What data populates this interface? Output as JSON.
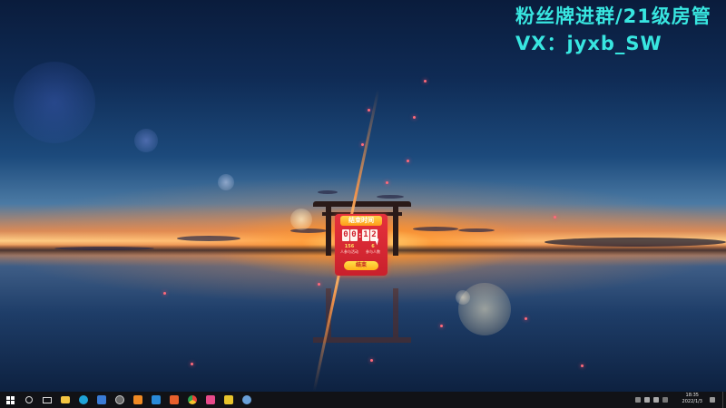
{
  "overlay": {
    "line1": "粉丝牌进群/21级房管",
    "line2": "VX：jyxb_SW",
    "color": "#38e6e0"
  },
  "widget": {
    "header": "结束时间",
    "timer": [
      "0",
      "0",
      "1",
      "2"
    ],
    "stats": [
      {
        "value": "156",
        "label": "人参与活动"
      },
      {
        "value": "6",
        "label": "参与人数"
      }
    ],
    "button": "结束"
  },
  "taskbar": {
    "items": [
      {
        "name": "start",
        "icon": "windows-start-icon",
        "color": "#ffffff"
      },
      {
        "name": "search",
        "icon": "search-icon",
        "color": "#dddddd"
      },
      {
        "name": "task-view",
        "icon": "task-view-icon",
        "color": "#dddddd"
      },
      {
        "name": "file-explorer",
        "icon": "folder-icon",
        "color": "#f4c542"
      },
      {
        "name": "edge",
        "icon": "edge-icon",
        "color": "#1fa3d8"
      },
      {
        "name": "store",
        "icon": "store-icon",
        "color": "#3a7bd5"
      },
      {
        "name": "obs",
        "icon": "obs-icon",
        "color": "#6a6a6a"
      },
      {
        "name": "app-orange",
        "icon": "app-orange-icon",
        "color": "#f08a24"
      },
      {
        "name": "app-blue",
        "icon": "app-blue-icon",
        "color": "#2a8ad8"
      },
      {
        "name": "app-red-orange",
        "icon": "app-red-orange-icon",
        "color": "#e8602c"
      },
      {
        "name": "chrome",
        "icon": "chrome-icon",
        "color": "#e8433a"
      },
      {
        "name": "app-pink",
        "icon": "app-pink-icon",
        "color": "#e84a8a"
      },
      {
        "name": "app-yellow",
        "icon": "app-yellow-icon",
        "color": "#e8c42c"
      },
      {
        "name": "settings",
        "icon": "gear-icon",
        "color": "#6aa0d8"
      }
    ],
    "time": "18:35",
    "date": "2022/1/3"
  }
}
